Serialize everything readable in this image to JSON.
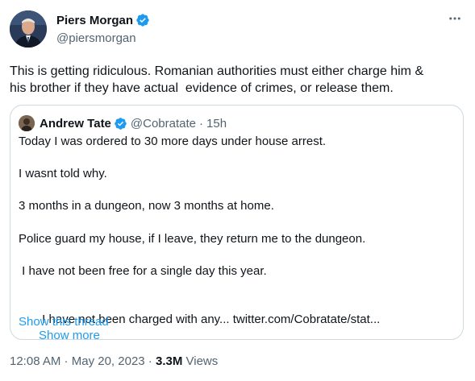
{
  "author": {
    "name": "Piers Morgan",
    "handle": "@piersmorgan"
  },
  "tweet": {
    "text": "This is getting ridiculous. Romanian authorities must either charge him &\nhis brother if they have actual  evidence of crimes, or release them."
  },
  "quote": {
    "name": "Andrew Tate",
    "handle": "@Cobratate",
    "separator": "·",
    "time": "15h",
    "lines": [
      "Today I was ordered to 30 more days under house arrest.",
      "I wasnt told why.",
      "3 months in a dungeon, now 3 months at home.",
      "Police guard my house, if I leave, they return me to the dungeon.",
      " I have not been free for a single day this year.",
      " I have not been charged with any... twitter.com/Cobratate/stat..."
    ],
    "show_more": "Show more",
    "show_thread": "Show this thread"
  },
  "footer": {
    "time": "12:08 AM",
    "separator": " · ",
    "date": "May 20, 2023",
    "views_count": "3.3M",
    "views_label": " Views"
  },
  "colors": {
    "accent": "#1d9bf0",
    "secondary_text": "#536471",
    "border": "#cfd9de"
  },
  "icons": {
    "verified": "verified-badge-icon",
    "more": "more-horizontal-icon"
  }
}
